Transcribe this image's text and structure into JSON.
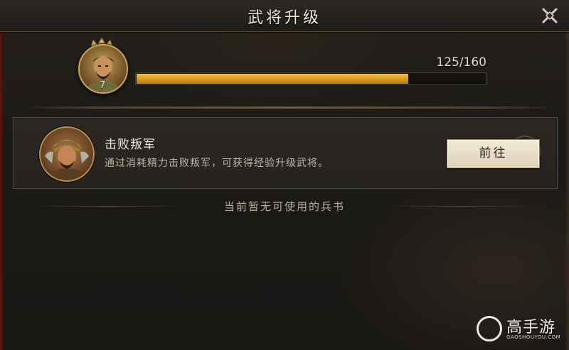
{
  "window": {
    "title": "武将升级"
  },
  "hero": {
    "level": "7",
    "exp_text": "125/160",
    "exp_current": 125,
    "exp_max": 160,
    "exp_fraction": 0.78125
  },
  "task_card": {
    "title": "击败叛军",
    "description": "通过消耗精力击败叛军，可获得经验升级武将。",
    "go_button_label": "前往"
  },
  "empty_notice": "当前暂无可使用的兵书",
  "watermark": {
    "name": "高手游",
    "url": "GAOSHOUYOU.COM"
  },
  "colors": {
    "exp_fill": "#d79b1d",
    "title_text": "#f1e6cf",
    "button_bg": "#e8dfc9",
    "card_border": "#5a4d3c"
  },
  "icons": {
    "close": "close-x-icon",
    "hero_avatar": "hero-portrait",
    "task_avatar": "rebel-general-portrait"
  }
}
